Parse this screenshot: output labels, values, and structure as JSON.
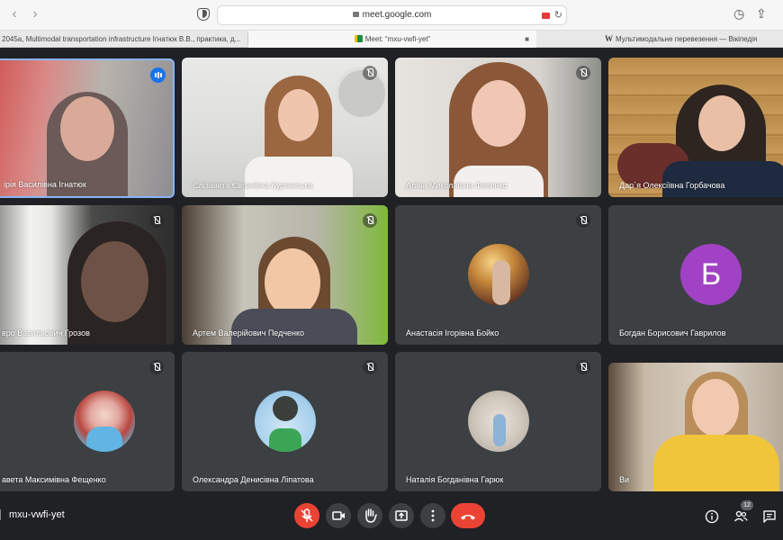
{
  "browser": {
    "url": "meet.google.com",
    "tabs": [
      {
        "label": "2045a, Multimodal transportation infrastructure Ігнатюк В.В., практика, д..."
      },
      {
        "label": "Meet: “mxu-vwfi-yet”"
      },
      {
        "label": "Мультимодальне перевезення — Вікіпедія"
      }
    ]
  },
  "participants": [
    {
      "name": "ірія Василівна Ігнатюк",
      "state": "speaking"
    },
    {
      "name": "Єлізавета Євгенівна Курганська",
      "state": "muted"
    },
    {
      "name": "Аліна Миколаївна Фесенко",
      "state": "muted"
    },
    {
      "name": "Дар`я Олексіївна Горбачова",
      "state": "unmuted"
    },
    {
      "name": "вро Васильович Грозов",
      "state": "muted"
    },
    {
      "name": "Артем Валерійович Педченко",
      "state": "muted"
    },
    {
      "name": "Анастасія Ігорівна Бойко",
      "state": "muted"
    },
    {
      "name": "Богдан Борисович Гаврилов",
      "state": "unmuted",
      "initial": "Б"
    },
    {
      "name": "авета Максимівна Фещенко",
      "state": "muted"
    },
    {
      "name": "Олександра Денисівна Ліпатова",
      "state": "muted"
    },
    {
      "name": "Наталія Богданівна Гарюк",
      "state": "muted"
    },
    {
      "name": "Ви",
      "state": "unmuted"
    }
  ],
  "meeting": {
    "code": "mxu-vwfi-yet",
    "participant_count": "12"
  },
  "colors": {
    "background": "#202124",
    "tile": "#3c4043",
    "danger": "#ea4335",
    "avatar_letter_bg": "#a142c4",
    "speaking_blue": "#1a73e8"
  },
  "icons": {
    "mic_off": "mic-off-icon",
    "camera": "camera-icon",
    "hand": "raise-hand-icon",
    "present": "present-icon",
    "more": "more-options-icon",
    "hangup": "hang-up-icon",
    "info": "info-icon",
    "people": "people-icon",
    "chat": "chat-icon"
  }
}
